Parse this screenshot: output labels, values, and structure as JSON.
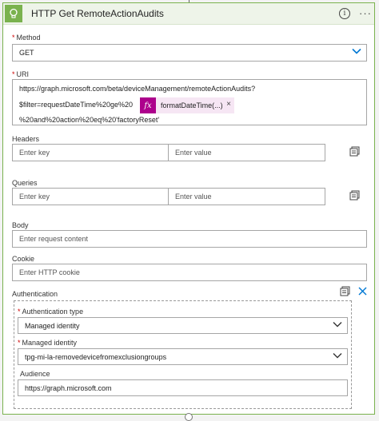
{
  "header": {
    "title": "HTTP Get RemoteActionAudits",
    "info_icon": "info-icon",
    "more_icon": "more-options-icon",
    "app_icon": "lightbulb-icon",
    "accent_color": "#7ab24e"
  },
  "method": {
    "label": "Method",
    "value": "GET"
  },
  "uri": {
    "label": "URI",
    "line1": "https://graph.microsoft.com/beta/deviceManagement/remoteActionAudits?",
    "line2": "$filter=requestDateTime%20ge%20",
    "token": {
      "icon": "fx",
      "text": "formatDateTime(...)",
      "close": "×",
      "color": "#ad008c"
    },
    "line3": "%20and%20action%20eq%20'factoryReset'"
  },
  "headers": {
    "label": "Headers",
    "key_placeholder": "Enter key",
    "value_placeholder": "Enter value"
  },
  "queries": {
    "label": "Queries",
    "key_placeholder": "Enter key",
    "value_placeholder": "Enter value"
  },
  "body": {
    "label": "Body",
    "placeholder": "Enter request content"
  },
  "cookie": {
    "label": "Cookie",
    "placeholder": "Enter HTTP cookie"
  },
  "authentication": {
    "label": "Authentication",
    "type_label": "Authentication type",
    "type_value": "Managed identity",
    "identity_label": "Managed identity",
    "identity_value": "tpg-mi-la-removedevicefromexclusiongroups",
    "audience_label": "Audience",
    "audience_value": "https://graph.microsoft.com",
    "close_color": "#0078d4"
  },
  "required_marker": "*"
}
